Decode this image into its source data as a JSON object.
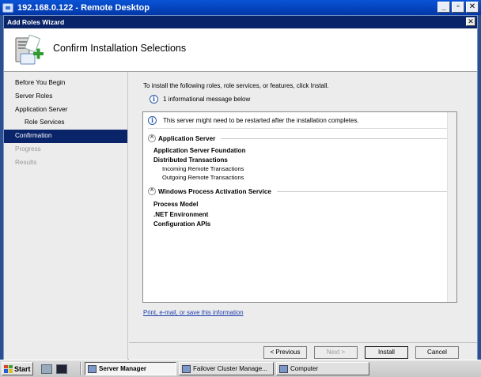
{
  "remote_desktop": {
    "title": "192.168.0.122 - Remote Desktop"
  },
  "window_controls": {
    "minimize": "_",
    "restore": "▫",
    "close": "✕"
  },
  "wizard": {
    "title": "Add Roles Wizard",
    "close_glyph": "✕",
    "header_title": "Confirm Installation Selections"
  },
  "nav": {
    "items": [
      {
        "label": "Before You Begin",
        "state": "normal"
      },
      {
        "label": "Server Roles",
        "state": "normal"
      },
      {
        "label": "Application Server",
        "state": "normal"
      },
      {
        "label": "Role Services",
        "state": "sub"
      },
      {
        "label": "Confirmation",
        "state": "active"
      },
      {
        "label": "Progress",
        "state": "disabled"
      },
      {
        "label": "Results",
        "state": "disabled"
      }
    ]
  },
  "content": {
    "intro": "To install the following roles, role services, or features, click Install.",
    "info_message": "1 informational message below",
    "restart_warning": "This server might need to be restarted after the installation completes.",
    "sections": [
      {
        "title": "Application Server",
        "items": [
          {
            "label": "Application Server Foundation",
            "bold": true
          },
          {
            "label": "Distributed Transactions",
            "bold": true
          },
          {
            "label": "Incoming Remote Transactions",
            "bold": false
          },
          {
            "label": "Outgoing Remote Transactions",
            "bold": false
          }
        ]
      },
      {
        "title": "Windows Process Activation Service",
        "items": [
          {
            "label": "Process Model",
            "bold": true
          },
          {
            "label": ".NET Environment",
            "bold": true
          },
          {
            "label": "Configuration APIs",
            "bold": true
          }
        ]
      }
    ],
    "link": "Print, e-mail, or save this information"
  },
  "buttons": {
    "previous": "< Previous",
    "next": "Next >",
    "install": "Install",
    "cancel": "Cancel"
  },
  "taskbar": {
    "start": "Start",
    "tasks": [
      {
        "label": "Server Manager",
        "active": true
      },
      {
        "label": "Failover Cluster Manage...",
        "active": false
      },
      {
        "label": "Computer",
        "active": false
      }
    ]
  },
  "colors": {
    "nav_active": "#0a246a",
    "link": "#1f3fae",
    "rd_titlebar": "#0138a8"
  }
}
